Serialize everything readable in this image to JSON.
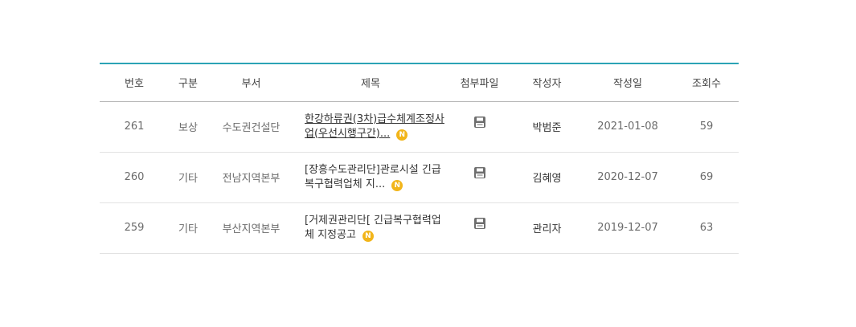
{
  "table": {
    "headers": {
      "no": "번호",
      "category": "구분",
      "department": "부서",
      "title": "제목",
      "attachment": "첨부파일",
      "author": "작성자",
      "date": "작성일",
      "views": "조회수"
    },
    "rows": [
      {
        "no": "261",
        "category": "보상",
        "department": "수도권건설단",
        "title": "한강하류권(3차)급수체계조정사업(우선시행구간)...",
        "badge": "N",
        "attachment_icon": "save-icon",
        "author": "박범준",
        "date": "2021-01-08",
        "views": "59"
      },
      {
        "no": "260",
        "category": "기타",
        "department": "전남지역본부",
        "title": "[장흥수도관리단]관로시설 긴급복구협력업체 지...",
        "badge": "N",
        "attachment_icon": "save-icon",
        "author": "김혜영",
        "date": "2020-12-07",
        "views": "69"
      },
      {
        "no": "259",
        "category": "기타",
        "department": "부산지역본부",
        "title": "[거제권관리단[ 긴급복구협력업체 지정공고",
        "badge": "N",
        "attachment_icon": "save-icon",
        "author": "관리자",
        "date": "2019-12-07",
        "views": "63"
      }
    ]
  },
  "colors": {
    "accent_border": "#2ba3b5",
    "badge": "#f2b51a"
  }
}
